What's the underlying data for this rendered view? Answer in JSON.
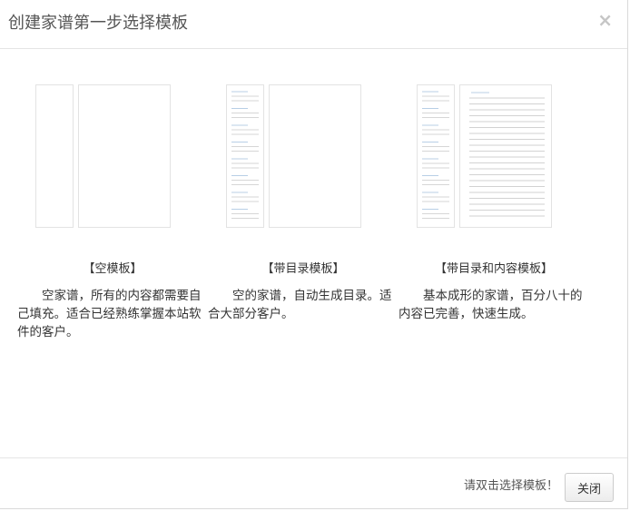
{
  "dialog": {
    "title": "创建家谱第一步选择模板",
    "close_symbol": "×"
  },
  "templates": [
    {
      "name": "【空模板】",
      "description": "空家谱，所有的内容都需要自己填充。适合已经熟练掌握本站软件的客户。",
      "thumbnail": "blank-template-thumbnail"
    },
    {
      "name": "【带目录模板】",
      "description": "空的家谱，自动生成目录。适合大部分客户。",
      "thumbnail": "toc-template-thumbnail"
    },
    {
      "name": "【带目录和内容模板】",
      "description": "基本成形的家谱，百分八十的内容已完善，快速生成。",
      "thumbnail": "toc-content-template-thumbnail"
    }
  ],
  "footer": {
    "hint": "请双击选择模板！",
    "close_label": "关闭"
  },
  "colors": {
    "page_border": "#e3e3e3",
    "toc_line_blue": "#b8cfe6",
    "toc_line_gray": "#d6d6d6",
    "content_line": "#d2d2d2"
  }
}
